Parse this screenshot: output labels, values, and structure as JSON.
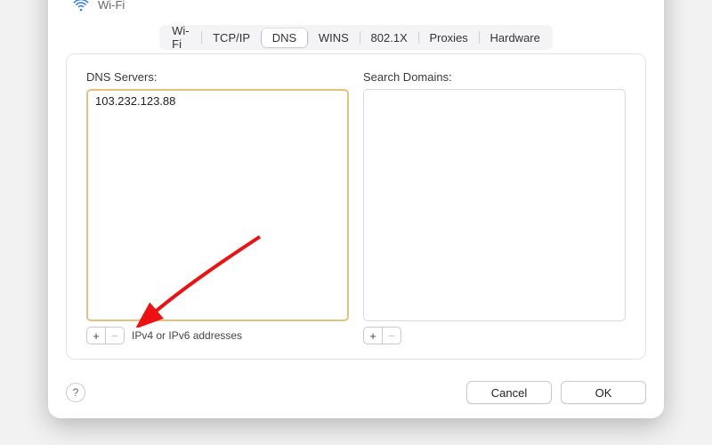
{
  "header": {
    "title": "Wi-Fi"
  },
  "tabs": {
    "wifi": "Wi-Fi",
    "tcpip": "TCP/IP",
    "dns": "DNS",
    "wins": "WINS",
    "8021x": "802.1X",
    "proxies": "Proxies",
    "hardware": "Hardware"
  },
  "dns": {
    "servers_label": "DNS Servers:",
    "servers": [
      "103.232.123.88"
    ],
    "hint": "IPv4 or IPv6 addresses"
  },
  "search": {
    "label": "Search Domains:"
  },
  "buttons": {
    "plus": "+",
    "minus": "−",
    "help": "?",
    "cancel": "Cancel",
    "ok": "OK"
  }
}
